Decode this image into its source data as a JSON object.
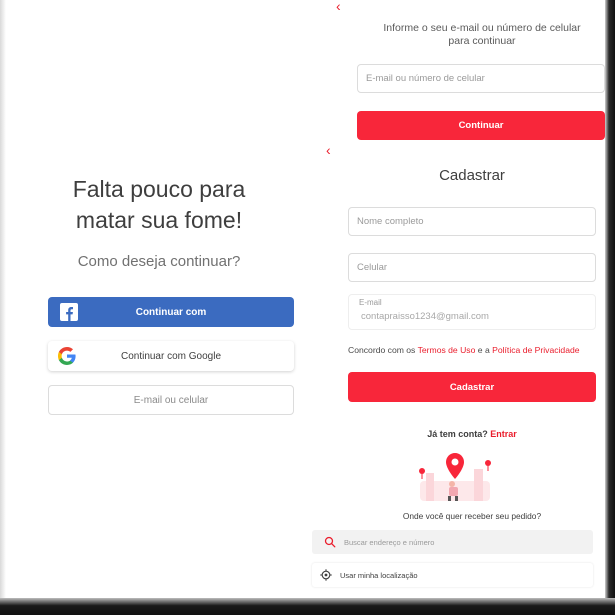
{
  "left": {
    "headline_line1": "Falta pouco para",
    "headline_line2": "matar sua fome!",
    "subheadline": "Como deseja continuar?",
    "facebook_button": "Continuar com",
    "google_button": "Continuar com Google",
    "email_button": "E-mail ou celular"
  },
  "right": {
    "login_instruction": "Informe o seu e-mail ou número de celular para continuar",
    "login_input_placeholder": "E-mail ou número de celular",
    "continue_button": "Continuar",
    "signup_title": "Cadastrar",
    "name_placeholder": "Nome completo",
    "phone_placeholder": "Celular",
    "email_label": "E-mail",
    "email_value": "contapraisso1234@gmail.com",
    "terms_prefix": "Concordo com os ",
    "terms_link": "Termos de Uso",
    "terms_mid": " e a ",
    "privacy_link": "Política de Privacidade",
    "signup_button": "Cadastrar",
    "have_account": "Já tem conta? ",
    "login_link": "Entrar",
    "delivery_question": "Onde você quer receber seu pedido?",
    "address_placeholder": "Buscar endereço e número",
    "use_location": "Usar minha localização"
  },
  "icons": {
    "back": "chevron-left-icon",
    "facebook": "facebook-icon",
    "google": "google-icon",
    "search": "search-icon",
    "location": "crosshair-icon"
  },
  "colors": {
    "brand_red": "#f8263a",
    "facebook_blue": "#3b6bc0",
    "link_red": "#ea1d2c"
  }
}
